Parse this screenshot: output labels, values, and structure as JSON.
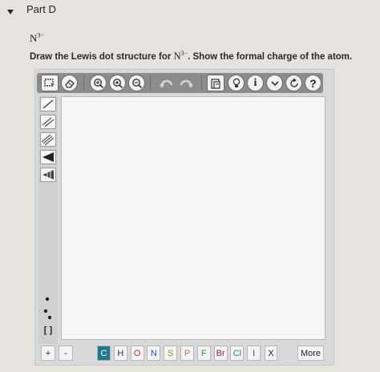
{
  "part": {
    "title": "Part D",
    "toggle_icon": "triangle-down-icon"
  },
  "ion": {
    "symbol": "N",
    "charge": "3−"
  },
  "question": {
    "prefix": "Draw the Lewis dot structure for",
    "formula_symbol": "N",
    "formula_charge": "3−",
    "suffix": ". Show the formal charge of the atom."
  },
  "toolbar": {
    "icons": [
      "select-lasso-icon",
      "eraser-icon",
      "zoom-in-icon",
      "zoom-fit-icon",
      "zoom-out-icon",
      "undo-icon",
      "redo-icon",
      "clipboard-icon",
      "lightbulb-icon",
      "info-icon",
      "chevron-down-icon",
      "reset-icon",
      "help-icon"
    ],
    "help_label": "?",
    "info_label": "i"
  },
  "left_tools": {
    "icons": [
      "single-bond-icon",
      "double-bond-icon",
      "triple-bond-icon",
      "wedge-bond-icon",
      "hash-bond-icon",
      "lone-electron-icon",
      "lone-pair-icon",
      "brackets-icon"
    ],
    "brackets_label": "[ ]"
  },
  "bottom_bar": {
    "charge_plus": "+",
    "charge_minus": "-",
    "elements": [
      {
        "symbol": "C",
        "color": "#ffffff",
        "bg": "#1e7a8a"
      },
      {
        "symbol": "H",
        "color": "#333333",
        "bg": "#f4f4f4"
      },
      {
        "symbol": "O",
        "color": "#cc2a2a",
        "bg": "#f4f4f4"
      },
      {
        "symbol": "N",
        "color": "#2a4fc0",
        "bg": "#f4f4f4"
      },
      {
        "symbol": "S",
        "color": "#a08a2a",
        "bg": "#f4f4f4"
      },
      {
        "symbol": "P",
        "color": "#d07a2a",
        "bg": "#f4f4f4"
      },
      {
        "symbol": "F",
        "color": "#3a8a3a",
        "bg": "#f4f4f4"
      },
      {
        "symbol": "Br",
        "color": "#8a2a2a",
        "bg": "#f4f4f4"
      },
      {
        "symbol": "Cl",
        "color": "#2a8a5a",
        "bg": "#f4f4f4"
      },
      {
        "symbol": "I",
        "color": "#6a2a8a",
        "bg": "#f4f4f4"
      }
    ],
    "close_label": "X",
    "more_label": "More"
  }
}
